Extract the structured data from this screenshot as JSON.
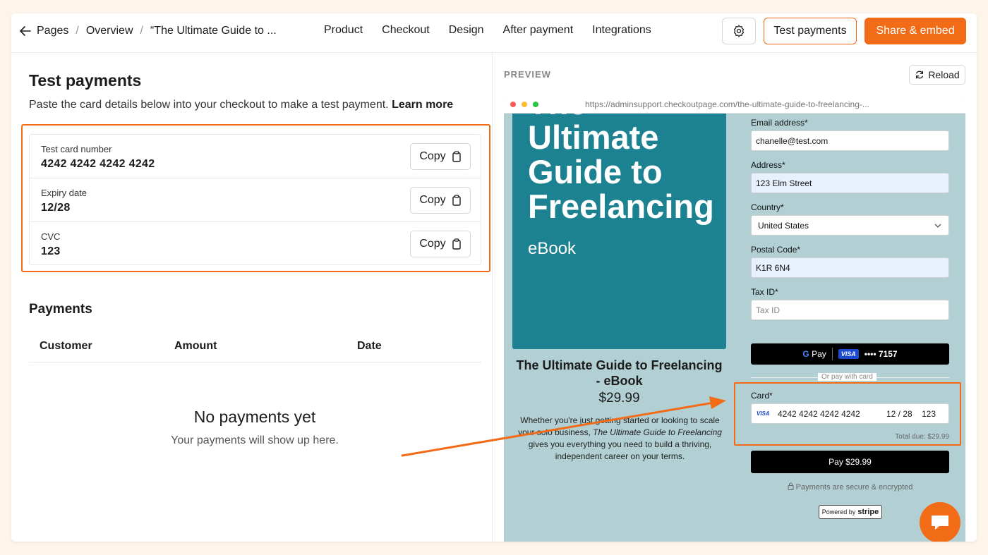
{
  "breadcrumb": {
    "pages": "Pages",
    "overview": "Overview",
    "current": "“The Ultimate Guide to ..."
  },
  "tabs": [
    "Product",
    "Checkout",
    "Design",
    "After payment",
    "Integrations"
  ],
  "toolbar": {
    "test_payments": "Test payments",
    "share_embed": "Share & embed"
  },
  "test_panel": {
    "title": "Test payments",
    "subtitle": "Paste the card details below into your checkout to make a test payment.",
    "learn_more": "Learn more",
    "rows": [
      {
        "label": "Test card number",
        "value": "4242 4242 4242 4242",
        "button": "Copy"
      },
      {
        "label": "Expiry date",
        "value": "12/28",
        "button": "Copy"
      },
      {
        "label": "CVC",
        "value": "123",
        "button": "Copy"
      }
    ]
  },
  "payments": {
    "title": "Payments",
    "columns": [
      "Customer",
      "Amount",
      "Date"
    ],
    "empty_title": "No payments yet",
    "empty_sub": "Your payments will show up here."
  },
  "preview": {
    "label": "PREVIEW",
    "reload": "Reload",
    "url": "https://adminsupport.checkoutpage.com/the-ultimate-guide-to-freelancing-...",
    "cover_title": "The Ultimate Guide to Freelancing",
    "cover_sub": "eBook",
    "product_title": "The Ultimate Guide to Freelancing - eBook",
    "price": "$29.99",
    "desc_1": "Whether you're just getting started or looking to scale your solo business,",
    "desc_em": "The Ultimate Guide to Freelancing",
    "desc_2": "gives you everything you need to build a thriving, independent career on your terms.",
    "form": {
      "email_label": "Email address",
      "email_value": "chanelle@test.com",
      "address_label": "Address",
      "address_value": "123 Elm Street",
      "country_label": "Country",
      "country_value": "United States",
      "postal_label": "Postal Code",
      "postal_value": "K1R 6N4",
      "tax_label": "Tax ID",
      "tax_placeholder": "Tax ID",
      "gpay_label": "Pay",
      "gpay_card": "•••• 7157",
      "or_pay": "Or pay with card",
      "card_label": "Card",
      "card_number": "4242 4242 4242 4242",
      "card_expiry": "12 / 28",
      "card_cvc": "123",
      "total": "Total due: $29.99",
      "pay_button": "Pay $29.99",
      "secure": "Payments are secure & encrypted",
      "powered_by": "Powered by",
      "stripe": "stripe",
      "required_mark": "*",
      "visa": "VISA"
    }
  },
  "colors": {
    "accent": "#f26b16",
    "cover": "#1c8190",
    "preview_bg": "#b2d0d3"
  }
}
